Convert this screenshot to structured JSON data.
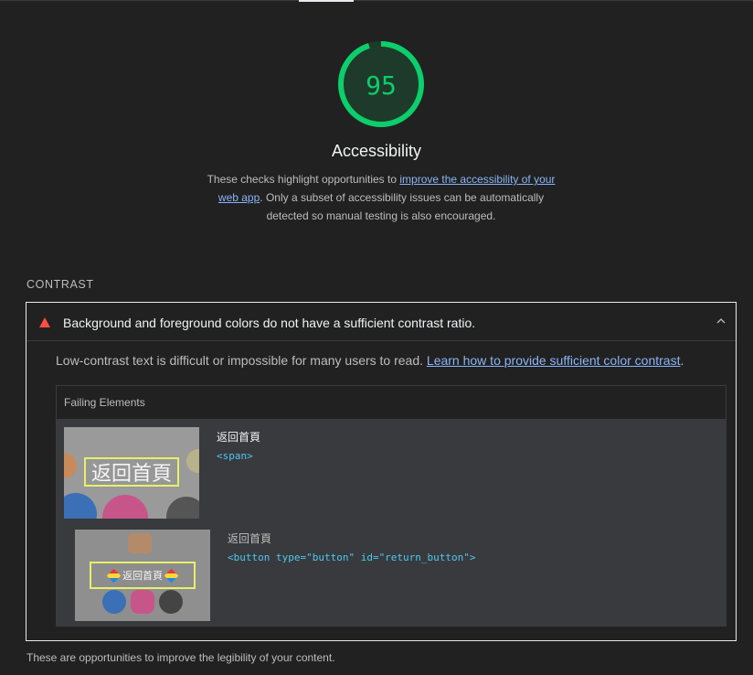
{
  "score": {
    "value": "95",
    "fraction": 0.95,
    "color": "#0cce6b"
  },
  "category": {
    "title": "Accessibility",
    "desc_prefix": "These checks highlight opportunities to ",
    "desc_link": "improve the accessibility of your web app",
    "desc_suffix": ". Only a subset of accessibility issues can be automatically detected so manual testing is also encouraged."
  },
  "group": {
    "title": "CONTRAST",
    "footer": "These are opportunities to improve the legibility of your content."
  },
  "audit": {
    "title": "Background and foreground colors do not have a sufficient contrast ratio.",
    "status": "fail",
    "desc_prefix": "Low-contrast text is difficult or impossible for many users to read. ",
    "desc_link": "Learn how to provide sufficient color contrast",
    "desc_suffix": "."
  },
  "table": {
    "header": "Failing Elements",
    "rows": [
      {
        "thumb_text": "返回首頁",
        "label": "返回首頁",
        "snippet": "<span>"
      },
      {
        "thumb_text": "返回首頁",
        "label": "返回首頁",
        "snippet": "<button type=\"button\" id=\"return_button\">"
      }
    ]
  },
  "icons": {
    "fail": "warning-triangle-icon",
    "collapse": "chevron-up-icon"
  },
  "colors": {
    "background": "#212121",
    "pass": "#0cce6b",
    "fail": "#ff4e42",
    "link": "#8ab4f8",
    "code": "#4ec8f0",
    "highlight": "#e6f06b"
  }
}
